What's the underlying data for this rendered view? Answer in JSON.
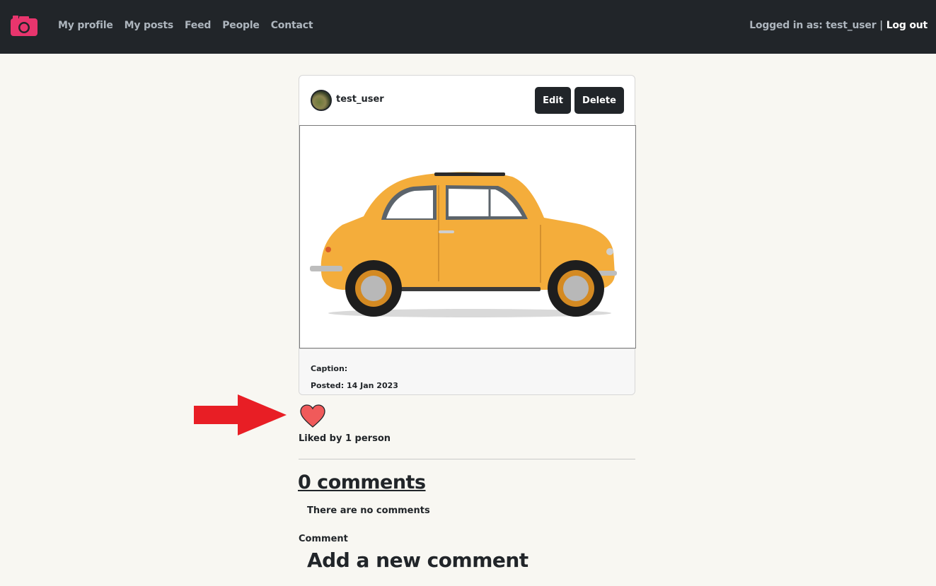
{
  "nav": {
    "logo_icon": "camera-icon",
    "links": [
      "My profile",
      "My posts",
      "Feed",
      "People",
      "Contact"
    ],
    "logged_in_text": "Logged in as: test_user |",
    "logout_label": "Log out"
  },
  "post": {
    "username": "test_user",
    "edit_label": "Edit",
    "delete_label": "Delete",
    "image_icon": "car-photo",
    "caption_label": "Caption:",
    "posted_label": "Posted: 14 Jan 2023"
  },
  "likes": {
    "heart_icon": "heart-icon",
    "liked_by": "Liked by 1 person"
  },
  "comments": {
    "title": "0 comments",
    "empty_text": "There are no comments",
    "comment_label": "Comment",
    "add_new_label": "Add a new comment"
  },
  "colors": {
    "navbar_bg": "#212529",
    "page_bg": "#f8f7f2",
    "logo": "#e8356d",
    "heart": "#f05a5a",
    "arrow": "#e81e25"
  }
}
